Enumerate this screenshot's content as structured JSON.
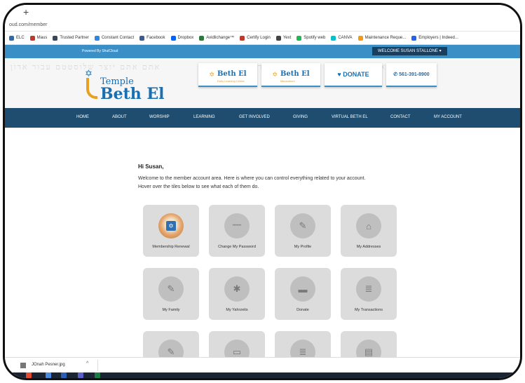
{
  "browser": {
    "new_tab": "+",
    "url": "oud.com/member",
    "bookmarks": [
      {
        "label": "ELC",
        "color": "#2b6cb0"
      },
      {
        "label": "Maus",
        "color": "#c0392b"
      },
      {
        "label": "Trusted Partner",
        "color": "#34495e"
      },
      {
        "label": "Constant Contact",
        "color": "#2e86de"
      },
      {
        "label": "Facebook",
        "color": "#3b5998"
      },
      {
        "label": "Dropbox",
        "color": "#0061fe"
      },
      {
        "label": "Avidlichange™",
        "color": "#2a7a3b"
      },
      {
        "label": "Certify Login",
        "color": "#c0392b"
      },
      {
        "label": "Yext",
        "color": "#444444"
      },
      {
        "label": "Spotify web",
        "color": "#1db954"
      },
      {
        "label": "CANVA",
        "color": "#00c4cc"
      },
      {
        "label": "Maintenance Reque...",
        "color": "#f39c12"
      },
      {
        "label": "Employers | Indeed...",
        "color": "#2164f3"
      }
    ]
  },
  "site": {
    "powered_by": "Powered By ShulCloud",
    "welcome": "WELCOME SUSAN STALLONE ▾",
    "hebrew_watermark": "אתם אתם יוצר שלוסטטם עבור אדון",
    "logo": {
      "line1": "Temple",
      "line2": "Beth El"
    },
    "header_boxes": [
      {
        "title": "Beth El",
        "sub": "Early Learning Center"
      },
      {
        "title": "Beth El",
        "sub": "Mausoleum"
      }
    ],
    "donate": "♥ DONATE",
    "phone": "✆ 561-391-8900",
    "nav": [
      "HOME",
      "ABOUT",
      "WORSHIP",
      "LEARNING",
      "GET INVOLVED",
      "GIVING",
      "VIRTUAL BETH EL",
      "CONTACT",
      "MY ACCOUNT"
    ]
  },
  "content": {
    "greeting": "Hi Susan,",
    "intro_line1": "Welcome to the member account area. Here is where you can control everything related to your account.",
    "intro_line2": "Hover over the tiles below to see what each of them do.",
    "tiles": [
      {
        "label": "Membership Renewal",
        "icon": "✡"
      },
      {
        "label": "Change My Password",
        "icon": "••••••"
      },
      {
        "label": "My Profile",
        "icon": "✎"
      },
      {
        "label": "My Addresses",
        "icon": "⌂"
      },
      {
        "label": "My Family",
        "icon": "✎"
      },
      {
        "label": "My Yahrzeits",
        "icon": "✱"
      },
      {
        "label": "Donate",
        "icon": "▬"
      },
      {
        "label": "My Transactions",
        "icon": "≣"
      },
      {
        "label": "",
        "icon": "✎"
      },
      {
        "label": "",
        "icon": "▭"
      },
      {
        "label": "",
        "icon": "≣"
      },
      {
        "label": "",
        "icon": "▤"
      }
    ]
  },
  "downloads": {
    "file": "JOnah Pesner.jpg",
    "chevron": "^"
  }
}
